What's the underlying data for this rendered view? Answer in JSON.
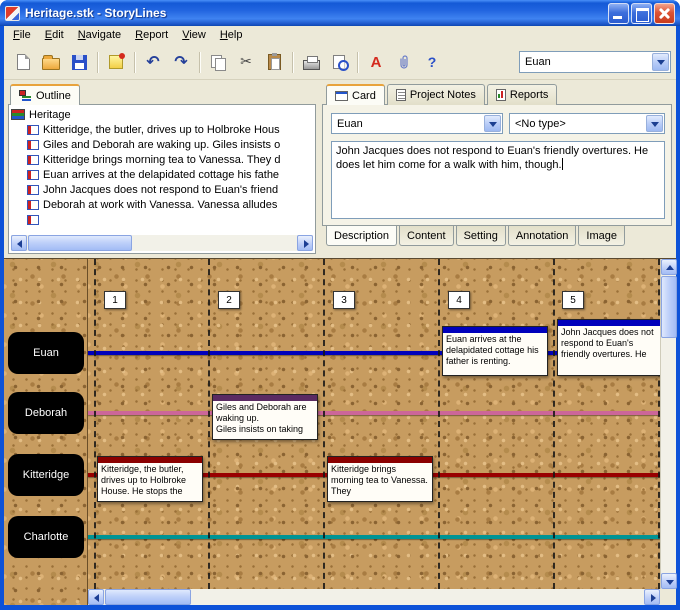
{
  "window": {
    "title": "Heritage.stk - StoryLines"
  },
  "menu": {
    "items": [
      "File",
      "Edit",
      "Navigate",
      "Report",
      "View",
      "Help"
    ]
  },
  "toolbar": {
    "icons": {
      "undo": "↶",
      "redo": "↷",
      "cut": "✂",
      "font": "A",
      "help": "?"
    },
    "character_combo_value": "Euan"
  },
  "outline_panel": {
    "tab_label": "Outline",
    "root_label": "Heritage",
    "items": [
      "Kitteridge, the butler, drives up to Holbroke Hous",
      "Giles and Deborah are waking up.  Giles insists o",
      "Kitteridge brings morning tea to Vanessa. They d",
      "Euan arrives at the delapidated cottage his fathe",
      "John Jacques does not respond to Euan's friend",
      "Deborah at work with Vanessa. Vanessa alludes",
      ""
    ]
  },
  "card_panel": {
    "tabs": [
      "Card",
      "Project Notes",
      "Reports"
    ],
    "character_combo_value": "Euan",
    "type_combo_value": "<No type>",
    "description_text": "John Jacques does not respond to Euan's friendly overtures. He does let him come for a walk with him, though.",
    "bottom_tabs": [
      "Description",
      "Content",
      "Setting",
      "Annotation",
      "Image"
    ]
  },
  "board": {
    "columns": [
      "1",
      "2",
      "3",
      "4",
      "5"
    ],
    "characters": [
      {
        "name": "Euan",
        "line_color": "#0000bb"
      },
      {
        "name": "Deborah",
        "line_color": "#cc6699"
      },
      {
        "name": "Kitteridge",
        "line_color": "#990000"
      },
      {
        "name": "Charlotte",
        "line_color": "#009494"
      }
    ],
    "cards": [
      {
        "column": "1",
        "character": "Kitteridge",
        "bar_color": "#8b0000",
        "text": "Kitteridge, the butler, drives up to Holbroke House. He stops the"
      },
      {
        "column": "2",
        "character": "Deborah",
        "bar_color": "#5a2a62",
        "text": "Giles and Deborah are waking up.\nGiles insists on taking "
      },
      {
        "column": "3",
        "character": "Kitteridge",
        "bar_color": "#8b0000",
        "text": "Kitteridge brings morning tea to Vanessa. They "
      },
      {
        "column": "4",
        "character": "Euan",
        "bar_color": "#0000bb",
        "text": "Euan arrives at the delapidated cottage his father is renting."
      },
      {
        "column": "5",
        "character": "Euan",
        "bar_color": "#0000bb",
        "text": "John Jacques does not respond to Euan's friendly overtures. He "
      }
    ]
  }
}
